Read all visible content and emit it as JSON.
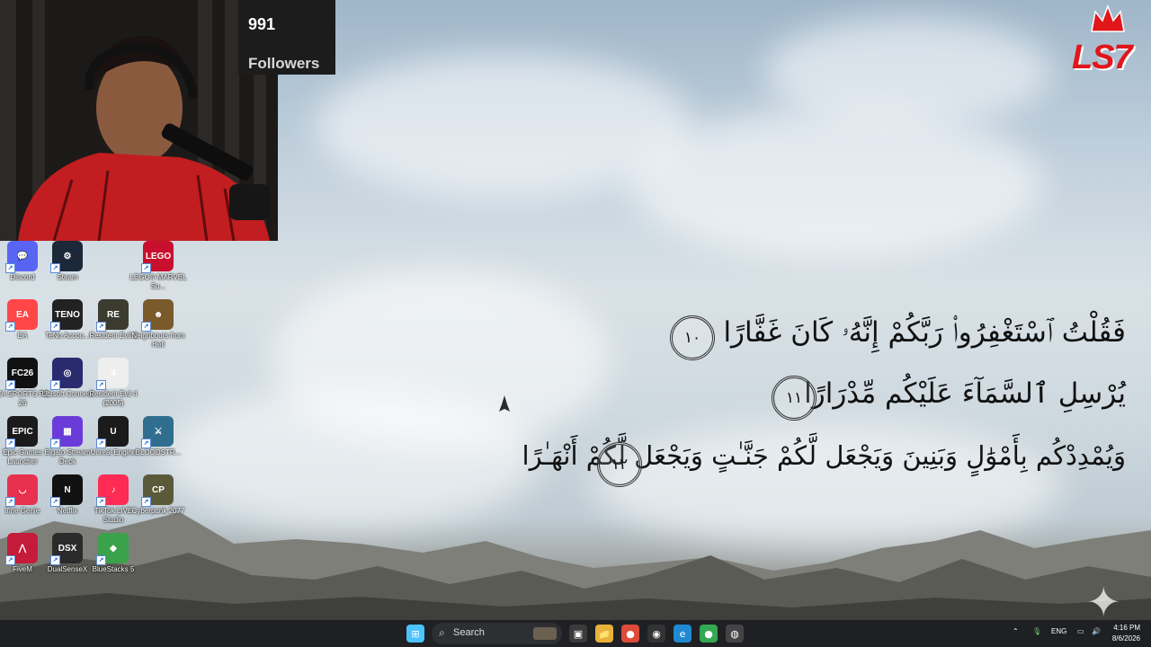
{
  "stream": {
    "followers_count": "991",
    "followers_label": "Followers",
    "logo_text": "LS7"
  },
  "desktop_icons": [
    {
      "label": "Discord",
      "icon": "discord-icon",
      "color": "#5865f2"
    },
    {
      "label": "Steam",
      "icon": "steam-icon",
      "color": "#1b2838"
    },
    {
      "label": "LEGO® MARVEL Su...",
      "icon": "lego-marvel-icon",
      "color": "#c8102e"
    },
    {
      "label": "EA",
      "icon": "ea-icon",
      "color": "#ff4747"
    },
    {
      "label": "TeNo Accou...",
      "icon": "teno-icon",
      "color": "#222222"
    },
    {
      "label": "Resident Evil 2",
      "icon": "resident-evil-2-icon",
      "color": "#3b3b2f"
    },
    {
      "label": "Neighbours from Hell",
      "icon": "neighbours-icon",
      "color": "#7a5a2a"
    },
    {
      "label": "EA SPORTS FC 26",
      "icon": "fc26-icon",
      "color": "#111111"
    },
    {
      "label": "Ubisoft Connect",
      "icon": "ubisoft-icon",
      "color": "#2a2a6e"
    },
    {
      "label": "Resident Evil 4 (2005)",
      "icon": "resident-evil-4-icon",
      "color": "#eeeeee"
    },
    {
      "label": "Epic Games Launcher",
      "icon": "epic-games-icon",
      "color": "#1b1b1b"
    },
    {
      "label": "Elgato Stream Deck",
      "icon": "stream-deck-icon",
      "color": "#6b3bd9"
    },
    {
      "label": "Unreal Engine",
      "icon": "unreal-engine-icon",
      "color": "#1b1b1b"
    },
    {
      "label": "BLOODSTR...",
      "icon": "bloodstrike-icon",
      "color": "#2f6e8e"
    },
    {
      "label": "ifine Genie",
      "icon": "genie-icon",
      "color": "#e8304f"
    },
    {
      "label": "Netflix",
      "icon": "netflix-icon",
      "color": "#111111"
    },
    {
      "label": "TikTok LIVE Studio",
      "icon": "tiktok-live-icon",
      "color": "#fe2c55"
    },
    {
      "label": "Cyberpunk 2077",
      "icon": "cyberpunk-icon",
      "color": "#5a5a3a"
    },
    {
      "label": "FiveM",
      "icon": "fivem-icon",
      "color": "#c41c3a"
    },
    {
      "label": "DualSenseX",
      "icon": "dualsensex-icon",
      "color": "#2b2b2b"
    },
    {
      "label": "BlueStacks 5",
      "icon": "bluestacks-icon",
      "color": "#3aa24a"
    }
  ],
  "icon_glyphs": {
    "discord": "💬",
    "steam": "⚙",
    "lego": "LEGO",
    "ea": "EA",
    "teno": "TENO",
    "re2": "RE",
    "neighbours": "☻",
    "fc": "FC26",
    "ubisoft": "◎",
    "re4": "4",
    "epic": "EPIC",
    "deck": "▦",
    "unreal": "U",
    "blood": "⚔",
    "genie": "◡",
    "netflix": "N",
    "tiktok": "♪",
    "cyber": "CP",
    "fivem": "⋀",
    "dsx": "DSX",
    "bluestacks": "◆"
  },
  "wallpaper": {
    "verses": [
      "فَقُلْتُ ٱسْتَغْفِرُوا۟ رَبَّكُمْ إِنَّهُۥ كَانَ غَفَّارًا",
      "يُرْسِلِ ٱلسَّمَآءَ عَلَيْكُم مِّدْرَارًا",
      "وَيُمْدِدْكُم بِأَمْوَٰلٍ وَبَنِينَ وَيَجْعَل لَّكُمْ جَنَّـٰتٍ وَيَجْعَل لَّكُمْ أَنْهَـٰرًا"
    ],
    "verse_numbers": [
      "١٠",
      "١١",
      "١٢"
    ]
  },
  "taskbar": {
    "search_placeholder": "Search",
    "language": "ENG",
    "time": "4:16 PM",
    "date": "8/6/2026",
    "pinned": [
      {
        "name": "start-icon",
        "glyph": "⊞",
        "color": "#4cc2ff"
      },
      {
        "name": "task-view-icon",
        "glyph": "▣",
        "color": "#3a3a3a"
      },
      {
        "name": "file-explorer-icon",
        "glyph": "📁",
        "color": "#e8b23a"
      },
      {
        "name": "chrome-icon",
        "glyph": "●",
        "color": "#dd4b39"
      },
      {
        "name": "obs-icon",
        "glyph": "◉",
        "color": "#333333"
      },
      {
        "name": "edge-icon",
        "glyph": "e",
        "color": "#1f8ad2"
      },
      {
        "name": "chrome-profile-icon",
        "glyph": "●",
        "color": "#34a853"
      },
      {
        "name": "app-icon",
        "glyph": "◍",
        "color": "#444444"
      }
    ],
    "tray_icons": [
      "chevron-up-icon",
      "microphone-icon",
      "network-icon",
      "speaker-icon"
    ]
  }
}
